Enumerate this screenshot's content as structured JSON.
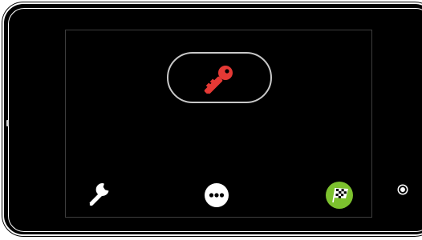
{
  "device": {
    "frame_color": "#000000",
    "outline_color": "#ffffff"
  },
  "screen": {
    "border_color": "#3e3e3e",
    "background": "#000000"
  },
  "controls": {
    "unlock": {
      "icon": "key-icon",
      "color": "#e53935"
    },
    "settings": {
      "icon": "wrench-icon",
      "color": "#ffffff"
    },
    "more": {
      "icon": "more-dots-icon",
      "color": "#ffffff"
    },
    "finish": {
      "icon": "checkered-flag-icon",
      "color": "#7cc12e"
    }
  }
}
